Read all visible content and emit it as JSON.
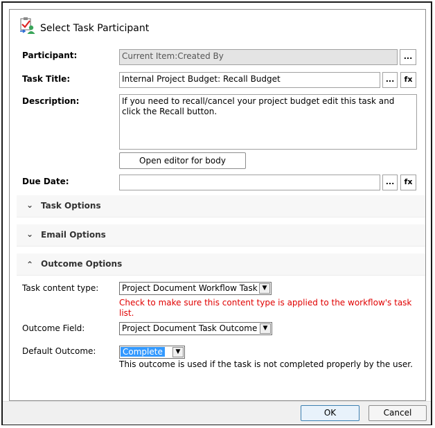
{
  "dialog": {
    "title": "Select Task Participant",
    "icon": "task-participant-icon"
  },
  "participant": {
    "label": "Participant:",
    "value": "Current Item:Created By",
    "browse": "..."
  },
  "task_title": {
    "label": "Task Title:",
    "value": "Internal Project Budget: Recall Budget",
    "browse": "...",
    "fx": "fx"
  },
  "description": {
    "label": "Description:",
    "value": "If you need to recall/cancel your project budget edit this task and click the Recall button.",
    "open_editor": "Open editor for body"
  },
  "due_date": {
    "label": "Due Date:",
    "value": "",
    "browse": "...",
    "fx": "fx"
  },
  "sections": {
    "task_options": {
      "label": "Task Options",
      "state": "collapsed"
    },
    "email_options": {
      "label": "Email Options",
      "state": "collapsed"
    },
    "outcome_options": {
      "label": "Outcome Options",
      "state": "expanded"
    }
  },
  "outcome": {
    "content_type_label": "Task content type:",
    "content_type_value": "Project Document Workflow Task",
    "content_type_warning": "Check to make sure this content type is applied to the workflow's task list.",
    "field_label": "Outcome Field:",
    "field_value": "Project Document Task Outcome",
    "default_label": "Default Outcome:",
    "default_value": "Complete",
    "default_note": "This outcome is used if the task is not completed properly by the user."
  },
  "buttons": {
    "ok": "OK",
    "cancel": "Cancel"
  },
  "colors": {
    "warning": "#e00000",
    "selection": "#3399ff",
    "section_bg": "#f7f7f7"
  }
}
